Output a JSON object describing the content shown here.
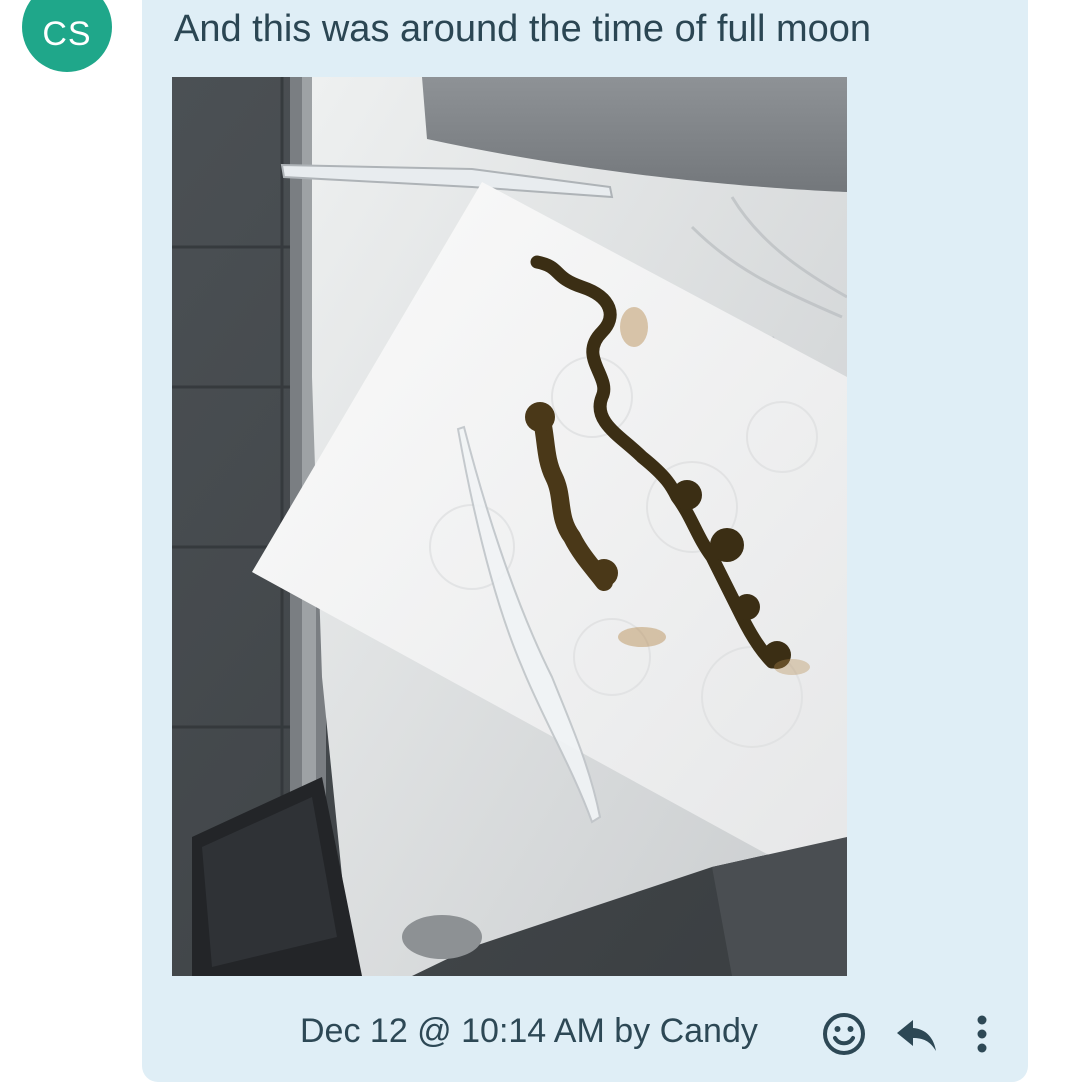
{
  "author": {
    "initials": "CS",
    "avatar_color": "#1fa78a"
  },
  "message": {
    "text": "And this was around the time of full moon",
    "attachment": {
      "type": "photo",
      "description_icon": "image-attachment"
    },
    "timestamp": "Dec 12 @ 10:14 AM",
    "author_label": "by Candy",
    "meta_line": "Dec 12 @ 10:14 AM by Candy"
  },
  "actions": {
    "react_icon": "smiley-icon",
    "reply_icon": "reply-arrow-icon",
    "more_icon": "vertical-ellipsis-icon"
  },
  "colors": {
    "bubble_bg": "#dfeef6",
    "text": "#2b4653",
    "icon": "#2d4855"
  }
}
